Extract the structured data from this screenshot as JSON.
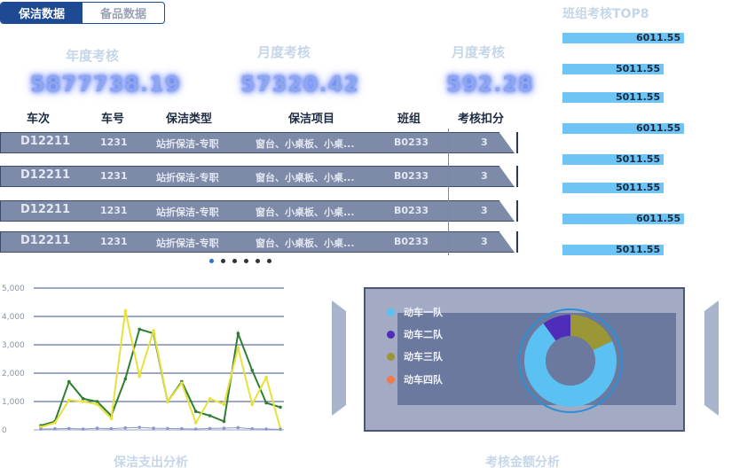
{
  "tabs": [
    {
      "label": "保洁数据",
      "active": true
    },
    {
      "label": "备品数据",
      "active": false
    }
  ],
  "kpis": [
    {
      "label": "年度考核",
      "value": "5877738.19"
    },
    {
      "label": "月度考核",
      "value": "57320.42"
    },
    {
      "label": "月度考核",
      "value": "592.28"
    }
  ],
  "table": {
    "headers": [
      "车次",
      "车号",
      "保洁类型",
      "保洁项目",
      "班组",
      "考核扣分"
    ],
    "rows": [
      [
        "D12211",
        "1231",
        "站折保洁-专职",
        "窗台、小桌板、小桌...",
        "B0233",
        "3"
      ],
      [
        "D12211",
        "1231",
        "站折保洁-专职",
        "窗台、小桌板、小桌...",
        "B0233",
        "3"
      ],
      [
        "D12211",
        "1231",
        "站折保洁-专职",
        "窗台、小桌板、小桌...",
        "B0233",
        "3"
      ],
      [
        "D12211",
        "1231",
        "站折保洁-专职",
        "窗台、小桌板、小桌...",
        "B0233",
        "3"
      ]
    ]
  },
  "pager": {
    "count": 6,
    "active": 0
  },
  "top8": {
    "title": "班组考核TOP8",
    "items": [
      {
        "value": 6011.55,
        "label": "6011.55"
      },
      {
        "value": 5011.55,
        "label": "5011.55"
      },
      {
        "value": 5011.55,
        "label": "5011.55"
      },
      {
        "value": 6011.55,
        "label": "6011.55"
      },
      {
        "value": 5011.55,
        "label": "5011.55"
      },
      {
        "value": 5011.55,
        "label": "5011.55"
      },
      {
        "value": 6011.55,
        "label": "6011.55"
      },
      {
        "value": 5011.55,
        "label": "5011.55"
      }
    ]
  },
  "line_chart": {
    "title": "保洁支出分析",
    "ylim": [
      0,
      5000
    ],
    "ticks": [
      "0",
      "1,000",
      "2,000",
      "3,000",
      "4,000",
      "5,000"
    ],
    "series": [
      {
        "color": "#2e7d32",
        "values": [
          150,
          300,
          1700,
          1100,
          1000,
          500,
          1800,
          3550,
          3400,
          1000,
          1700,
          650,
          500,
          300,
          3400,
          2100,
          950,
          800
        ]
      },
      {
        "color": "#e6e23a",
        "values": [
          100,
          250,
          1050,
          1000,
          900,
          400,
          4200,
          1900,
          3500,
          1000,
          1650,
          250,
          1100,
          900,
          2900,
          900,
          1850,
          50
        ]
      },
      {
        "color": "#8d97c8",
        "values": [
          30,
          40,
          50,
          30,
          60,
          40,
          70,
          90,
          60,
          50,
          40,
          30,
          50,
          60,
          80,
          40,
          30,
          20
        ]
      }
    ]
  },
  "donut": {
    "title": "考核金额分析",
    "legend": [
      {
        "label": "动车一队",
        "color": "#5bc1f2",
        "value": 72
      },
      {
        "label": "动车二队",
        "color": "#4e2eb8",
        "value": 10
      },
      {
        "label": "动车三队",
        "color": "#9b9636",
        "value": 18
      },
      {
        "label": "动车四队",
        "color": "#ee7a4e",
        "value": 0
      }
    ],
    "ring_color": "#2b8fd6"
  }
}
